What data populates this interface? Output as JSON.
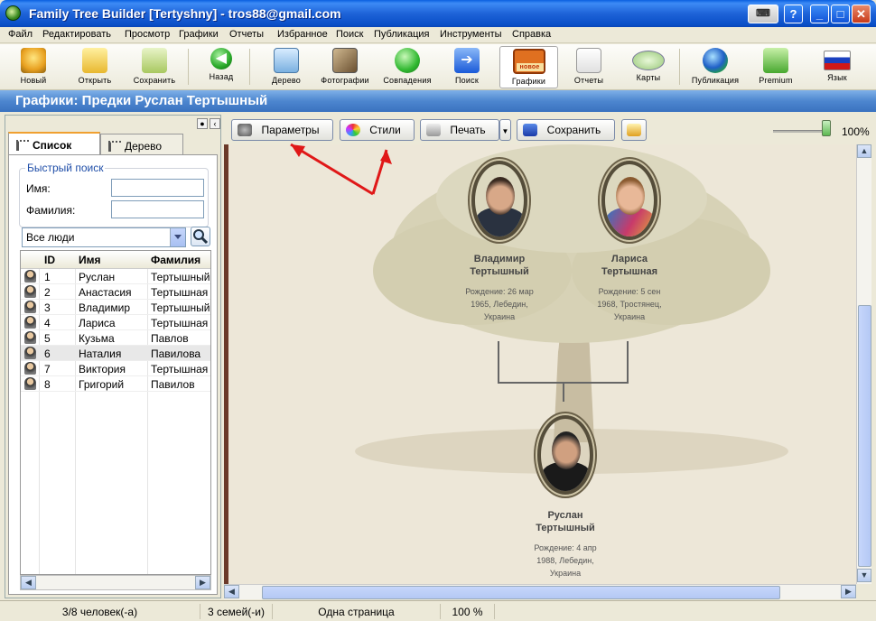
{
  "window": {
    "title": "Family Tree Builder [Tertyshny] - tros88@gmail.com",
    "help_label": "?",
    "minimize_label": "_",
    "maximize_label": "□",
    "close_label": "✕"
  },
  "menu": [
    "Файл",
    "Редактировать",
    "Просмотр",
    "Графики",
    "Отчеты",
    "Избранное",
    "Поиск",
    "Публикация",
    "Инструменты",
    "Справка"
  ],
  "toolbar": {
    "new": "Новый",
    "open": "Открыть",
    "save": "Сохранить",
    "back": "Назад",
    "tree": "Дерево",
    "photos": "Фотографии",
    "matches": "Совпадения",
    "search": "Поиск",
    "charts": "Графики",
    "charts_badge": "новое",
    "reports": "Отчеты",
    "maps": "Карты",
    "publish": "Публикация",
    "premium": "Premium",
    "language": "Язык"
  },
  "banner": {
    "title": "Графики: Предки Руслан Тертышный"
  },
  "left_panel": {
    "tabs": {
      "list": "Список",
      "tree": "Дерево"
    },
    "quick_search": {
      "legend": "Быстрый поиск",
      "first_name_label": "Имя:",
      "last_name_label": "Фамилия:",
      "first_name_value": "",
      "last_name_value": ""
    },
    "filter": "Все люди",
    "columns": {
      "id": "ID",
      "first": "Имя",
      "last": "Фамилия"
    },
    "rows": [
      {
        "id": "1",
        "first": "Руслан",
        "last": "Тертышный"
      },
      {
        "id": "2",
        "first": "Анастасия",
        "last": "Тертышная"
      },
      {
        "id": "3",
        "first": "Владимир",
        "last": "Тертышный"
      },
      {
        "id": "4",
        "first": "Лариса",
        "last": "Тертышная"
      },
      {
        "id": "5",
        "first": "Кузьма",
        "last": "Павлов"
      },
      {
        "id": "6",
        "first": "Наталия",
        "last": "Павилова"
      },
      {
        "id": "7",
        "first": "Виктория",
        "last": "Тертышная"
      },
      {
        "id": "8",
        "first": "Григорий",
        "last": "Павилов"
      }
    ],
    "selected_row": 6
  },
  "chart_toolbar": {
    "params": "Параметры",
    "styles": "Стили",
    "print": "Печать",
    "save": "Сохранить",
    "zoom": "100%"
  },
  "people": {
    "father": {
      "name1": "Владимир",
      "name2": "Тертышный",
      "info1": "Рождение: 26 мар",
      "info2": "1965, Лебедин,",
      "info3": "Украина"
    },
    "mother": {
      "name1": "Лариса",
      "name2": "Тертышная",
      "info1": "Рождение: 5 сен",
      "info2": "1968, Тростянец,",
      "info3": "Украина"
    },
    "child": {
      "name1": "Руслан",
      "name2": "Тертышный",
      "info1": "Рождение: 4 апр",
      "info2": "1988, Лебедин,",
      "info3": "Украина"
    }
  },
  "status": {
    "persons": "3/8 человек(-а)",
    "families": "3 семей(-и)",
    "pages": "Одна страница",
    "zoom": "100 %"
  }
}
